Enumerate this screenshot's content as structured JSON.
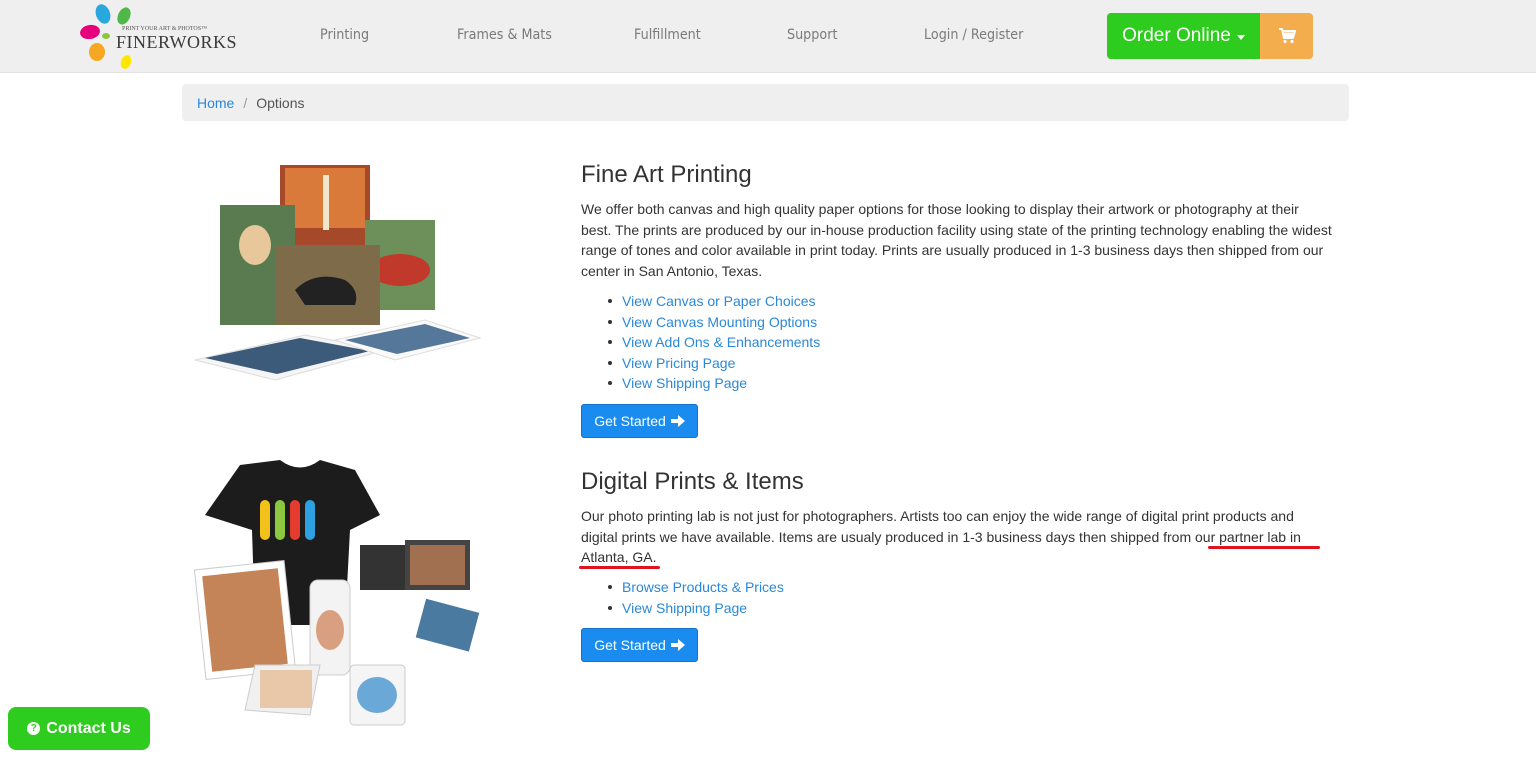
{
  "brand": {
    "name": "FINERWORKS",
    "tagline": "PRINT YOUR ART & PHOTOS™"
  },
  "nav": {
    "items": [
      {
        "label": "Printing"
      },
      {
        "label": "Frames & Mats"
      },
      {
        "label": "Fulfillment"
      },
      {
        "label": "Support"
      },
      {
        "label": "Login / Register"
      }
    ],
    "order_label": "Order Online"
  },
  "breadcrumb": {
    "home": "Home",
    "separator": "/",
    "current": "Options"
  },
  "sections": [
    {
      "title": "Fine Art Printing",
      "description": "We offer both canvas and high quality paper options for those looking to display their artwork or photography at their best. The prints are produced by our in-house production facility using state of the printing technology enabling the widest range of tones and color available in print today. Prints are usually produced in 1-3 business days then shipped from our center in San Antonio, Texas.",
      "links": [
        "View Canvas or Paper Choices",
        "View Canvas Mounting Options",
        "View Add Ons & Enhancements",
        "View Pricing Page",
        "View Shipping Page"
      ],
      "button": "Get Started"
    },
    {
      "title": "Digital Prints & Items",
      "description": "Our photo printing lab is not just for photographers. Artists too can enjoy the wide range of digital print products and digital prints we have available. Items are usualy produced in 1-3 business days then shipped from our partner lab in Atlanta, GA.",
      "links": [
        "Browse Products & Prices",
        "View Shipping Page"
      ],
      "button": "Get Started"
    }
  ],
  "contact": {
    "label": "Contact Us"
  },
  "colors": {
    "green": "#2ecc1f",
    "orange": "#f4ad4c",
    "link": "#2a88d8",
    "button": "#1a8cf0",
    "annotation": "#e0141e"
  }
}
